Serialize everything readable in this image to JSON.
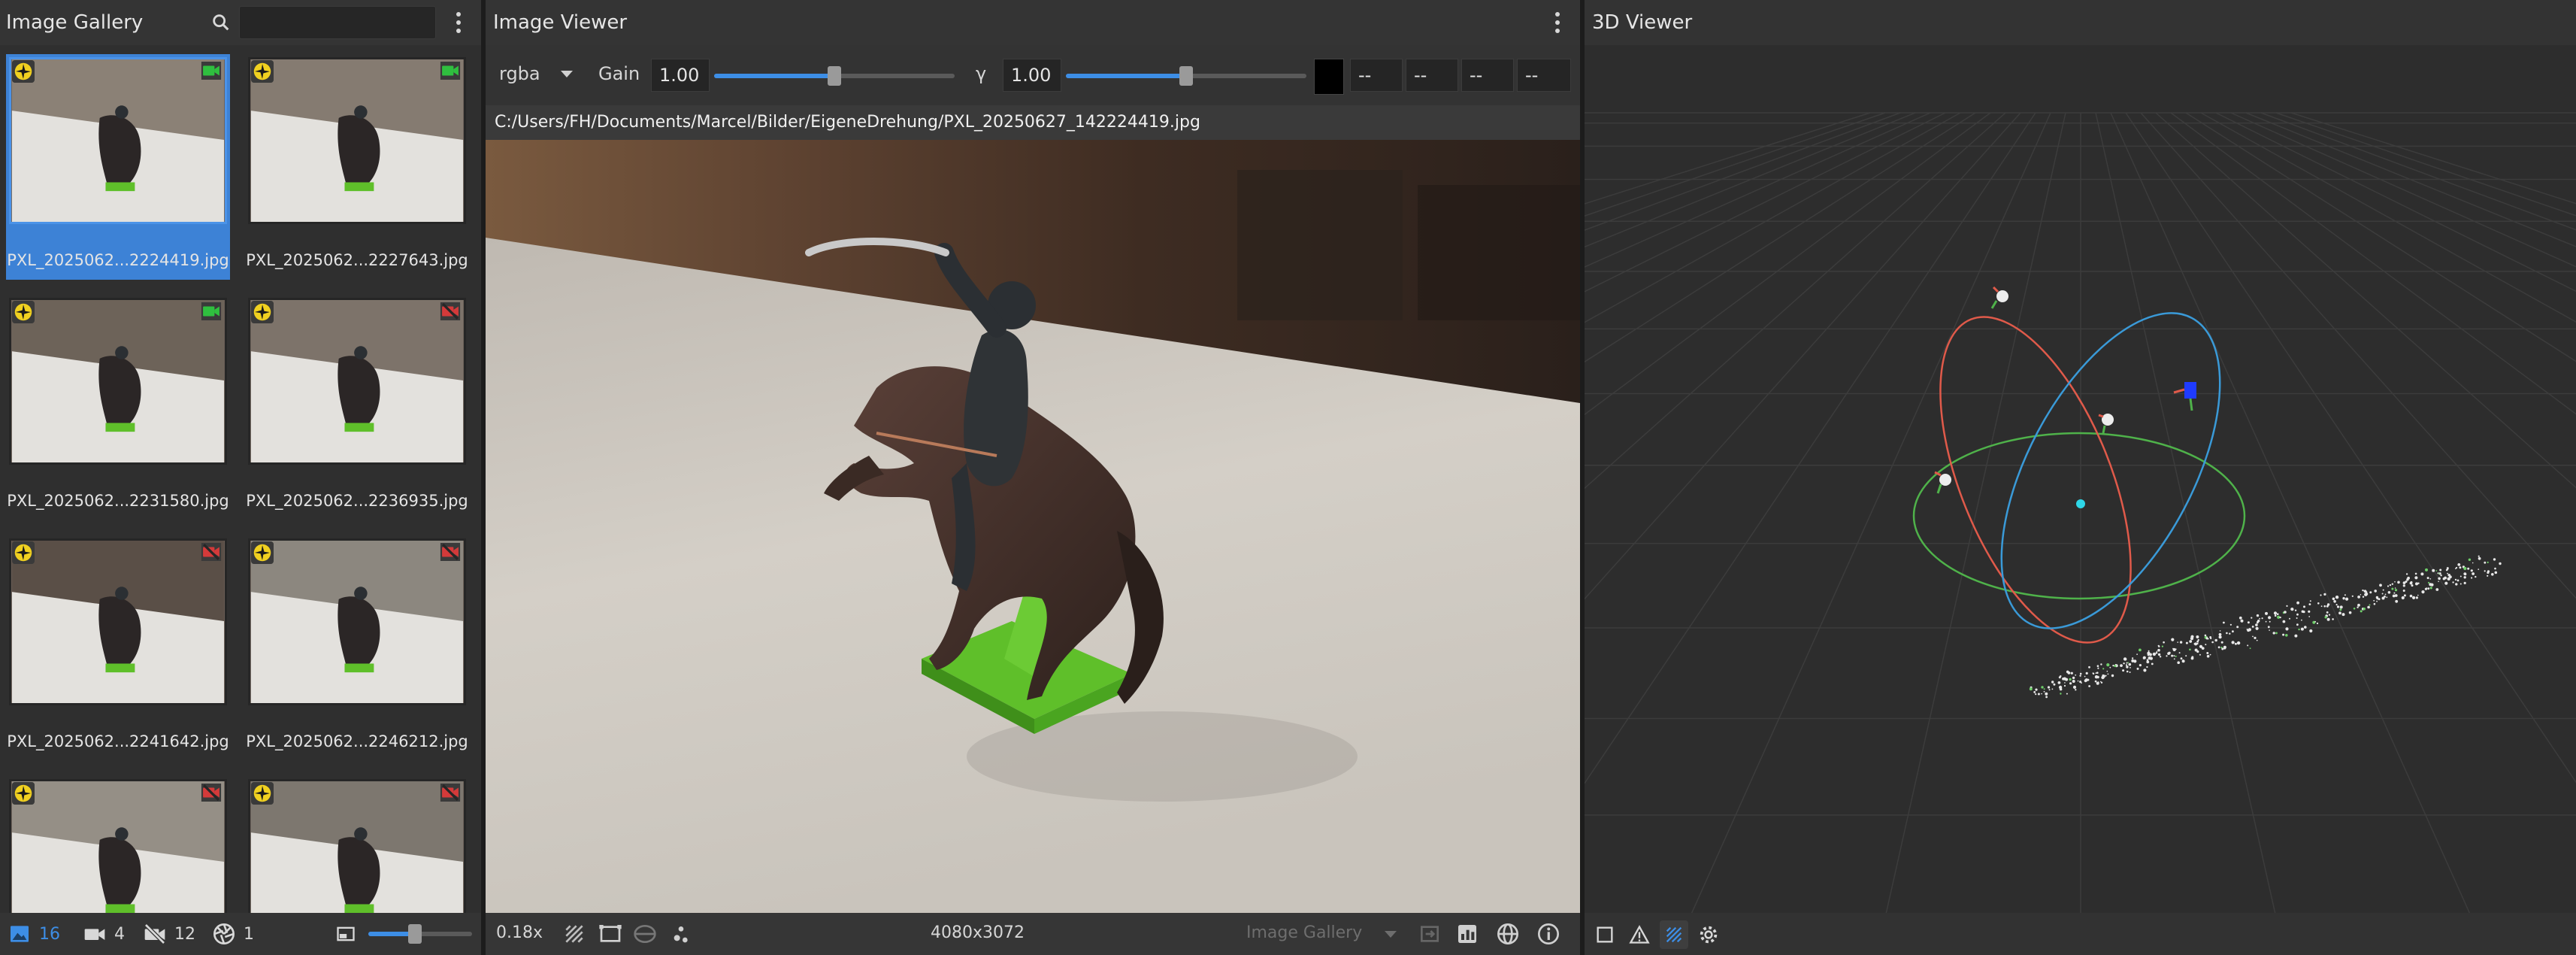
{
  "gallery": {
    "title": "Image Gallery",
    "search_placeholder": "",
    "thumbnails": [
      {
        "label": "PXL_2025062...2224419.jpg",
        "camera_status": "green",
        "selected": true
      },
      {
        "label": "PXL_2025062...2227643.jpg",
        "camera_status": "green",
        "selected": false
      },
      {
        "label": "PXL_2025062...2231580.jpg",
        "camera_status": "green",
        "selected": false
      },
      {
        "label": "PXL_2025062...2236935.jpg",
        "camera_status": "red",
        "selected": false
      },
      {
        "label": "PXL_2025062...2241642.jpg",
        "camera_status": "red",
        "selected": false
      },
      {
        "label": "PXL_2025062...2246212.jpg",
        "camera_status": "red",
        "selected": false
      },
      {
        "label": "",
        "camera_status": "red",
        "selected": false
      },
      {
        "label": "",
        "camera_status": "red",
        "selected": false
      }
    ],
    "footer": {
      "images_count": "16",
      "cameras_count": "4",
      "no_camera_count": "12",
      "intrinsics_count": "1",
      "thumbnail_size_level": 0.45
    }
  },
  "viewer": {
    "title": "Image Viewer",
    "channel_mode": "rgba",
    "gain_label": "Gain",
    "gain_value": "1.00",
    "gain_level": 0.5,
    "gamma_label": "γ",
    "gamma_value": "1.00",
    "gamma_level": 0.5,
    "pixel_values": [
      "--",
      "--",
      "--",
      "--"
    ],
    "image_path": "C:/Users/FH/Documents/Marcel/Bilder/EigeneDrehung/PXL_20250627_142224419.jpg",
    "footer": {
      "zoom": "0.18x",
      "resolution": "4080x3072",
      "source_select": "Image Gallery"
    }
  },
  "viewer3d": {
    "title": "3D Viewer"
  },
  "colors": {
    "accent": "#3d8ee6",
    "panel_bg": "#2f2f2f",
    "header_bg": "#343434",
    "camera_ok": "#2fbf3f",
    "camera_missing": "#d43a3a",
    "gizmo_red": "#e05a4a",
    "gizmo_green": "#4fb24a",
    "gizmo_blue": "#3a9ad8"
  }
}
